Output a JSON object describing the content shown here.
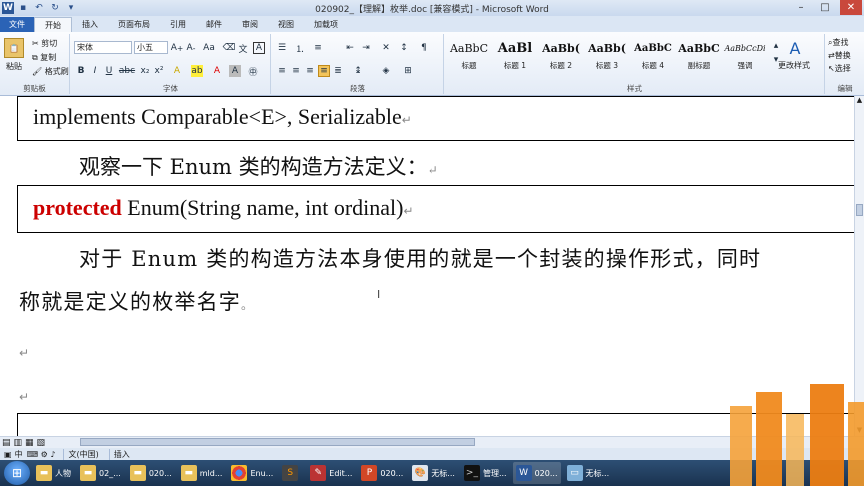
{
  "window": {
    "title": "020902_【理解】枚举.doc [兼容模式] - Microsoft Word",
    "app_icon_letter": "W"
  },
  "tabs": [
    "文件",
    "开始",
    "插入",
    "页面布局",
    "引用",
    "邮件",
    "审阅",
    "视图",
    "加载项"
  ],
  "ribbon": {
    "clipboard": {
      "paste": "粘贴",
      "cut": "剪切",
      "copy": "复制",
      "format_painter": "格式刷",
      "label": "剪贴板"
    },
    "font": {
      "name": "宋体",
      "size": "小五",
      "label": "字体"
    },
    "paragraph": {
      "label": "段落"
    },
    "styles": {
      "label": "样式",
      "items": [
        {
          "sample": "AaBbC",
          "name": "标题"
        },
        {
          "sample": "AaBl",
          "name": "标题 1"
        },
        {
          "sample": "AaBb(",
          "name": "标题 2"
        },
        {
          "sample": "AaBb(",
          "name": "标题 3"
        },
        {
          "sample": "AaBbC",
          "name": "标题 4"
        },
        {
          "sample": "AaBbC",
          "name": "副标题"
        },
        {
          "sample": "AaBbCcDi",
          "name": "强调"
        }
      ],
      "change_styles": "更改样式"
    },
    "editing": {
      "find": "查找",
      "replace": "替换",
      "select": "选择",
      "label": "编辑"
    }
  },
  "document": {
    "line1": "implements Comparable<E>, Serializable",
    "line2": "观察一下 Enum 类的构造方法定义：",
    "line3_kw": "protected",
    "line3_rest": " Enum(String name, int ordinal)",
    "line4": "对于 Enum 类的构造方法本身使用的就是一个封装的操作形式，同时",
    "line5": "称就是定义的枚举名字",
    "para_mark": "↵",
    "period_mark": "。"
  },
  "statusbar": {
    "lang": "文(中国)",
    "mode": "插入",
    "ime": "中"
  },
  "taskbar": {
    "items": [
      {
        "label": "人物",
        "icon": "folder-icon"
      },
      {
        "label": "02_...",
        "icon": "folder-icon"
      },
      {
        "label": "020...",
        "icon": "folder-icon"
      },
      {
        "label": "mld...",
        "icon": "folder-icon"
      },
      {
        "label": "Enu...",
        "icon": "chrome-icon"
      },
      {
        "label": "Edit...",
        "icon": "editor-icon"
      },
      {
        "label": "020...",
        "icon": "powerpoint-icon"
      },
      {
        "label": "无标...",
        "icon": "paint-icon"
      },
      {
        "label": "管理...",
        "icon": "cmd-icon"
      },
      {
        "label": "020...",
        "icon": "word-icon"
      },
      {
        "label": "无标...",
        "icon": "window-icon"
      }
    ]
  },
  "colors": {
    "keyword": "#cc0000",
    "ribbon_file_tab": "#2b63b6",
    "taskbar": "#1f3a5c",
    "decor_orange": "#f08a1e"
  }
}
